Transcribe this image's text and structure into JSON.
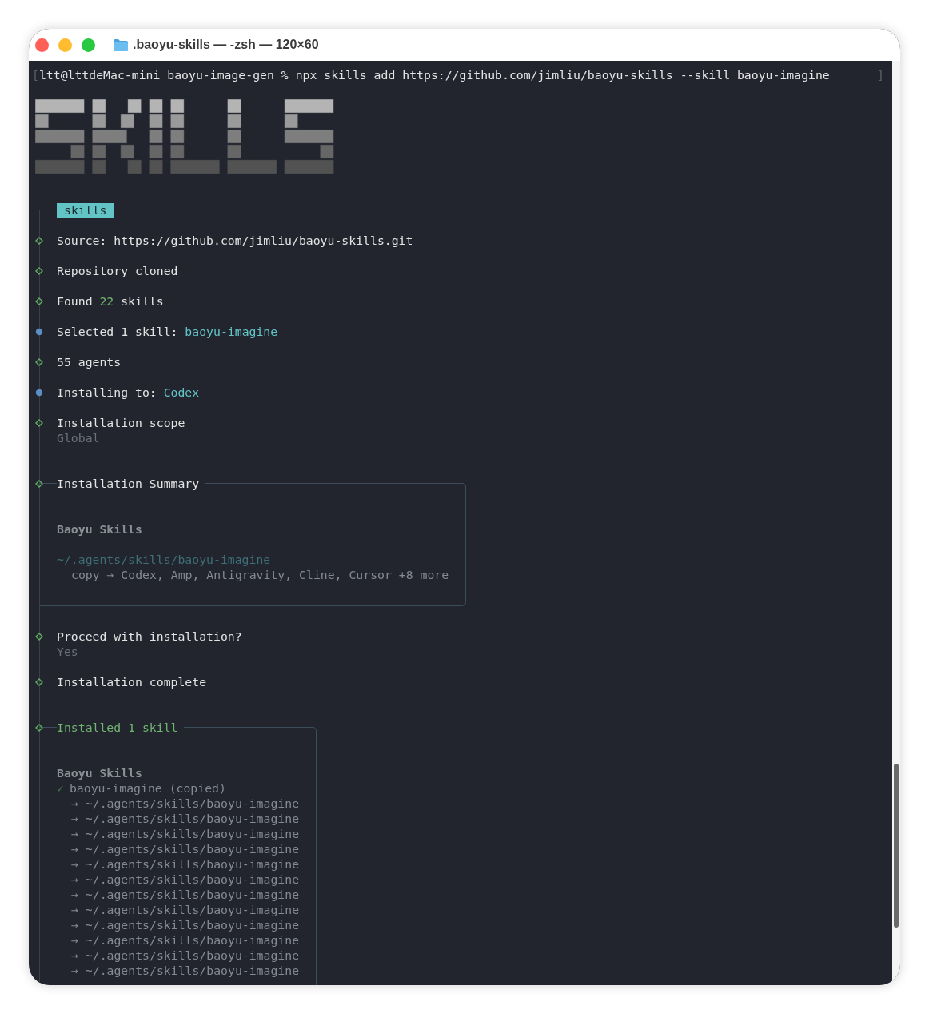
{
  "window": {
    "title": ".baoyu-skills — -zsh — 120×60"
  },
  "terminal": {
    "command": {
      "open_bracket": "[",
      "text": "ltt@lttdeMac-mini baoyu-image-gen % npx skills add https://github.com/jimliu/baoyu-skills --skill baoyu-imagine",
      "close_bracket": "]"
    },
    "badge": "skills",
    "entries": [
      {
        "kind": "step",
        "active": false,
        "parts": [
          {
            "text": "Source: https://github.com/jimliu/baoyu-skills.git",
            "kind": "plain"
          }
        ]
      },
      {
        "kind": "step",
        "active": false,
        "parts": [
          {
            "text": "Repository cloned",
            "kind": "plain"
          }
        ]
      },
      {
        "kind": "step",
        "active": false,
        "parts": [
          {
            "text": "Found ",
            "kind": "plain"
          },
          {
            "text": "22",
            "kind": "number"
          },
          {
            "text": " skills",
            "kind": "plain"
          }
        ]
      },
      {
        "kind": "step",
        "active": true,
        "parts": [
          {
            "text": "Selected 1 skill: ",
            "kind": "plain"
          },
          {
            "text": "baoyu-imagine",
            "kind": "accent"
          }
        ]
      },
      {
        "kind": "step",
        "active": false,
        "parts": [
          {
            "text": "55 agents",
            "kind": "plain"
          }
        ]
      },
      {
        "kind": "step",
        "active": true,
        "parts": [
          {
            "text": "Installing to: ",
            "kind": "plain"
          },
          {
            "text": "Codex",
            "kind": "accent"
          }
        ]
      },
      {
        "kind": "step",
        "active": false,
        "parts": [
          {
            "text": "Installation scope",
            "kind": "plain"
          }
        ],
        "detail": "Global"
      },
      {
        "kind": "box",
        "active": false,
        "title": "Installation Summary",
        "title_success": false,
        "lines": [
          {
            "kind": "blank"
          },
          {
            "kind": "blank"
          },
          {
            "kind": "heading",
            "text": "Baoyu Skills"
          },
          {
            "kind": "blank"
          },
          {
            "kind": "path",
            "text": "~/.agents/skills/baoyu-imagine"
          },
          {
            "kind": "note",
            "text": "copy → Codex, Amp, Antigravity, Cline, Cursor +8 more"
          },
          {
            "kind": "blank"
          }
        ]
      },
      {
        "kind": "step",
        "active": false,
        "parts": [
          {
            "text": "Proceed with installation?",
            "kind": "plain"
          }
        ],
        "detail": "Yes"
      },
      {
        "kind": "step",
        "active": false,
        "parts": [
          {
            "text": "Installation complete",
            "kind": "plain"
          }
        ]
      },
      {
        "kind": "box",
        "active": false,
        "title": "Installed 1 skill",
        "title_success": true,
        "lines": [
          {
            "kind": "blank"
          },
          {
            "kind": "blank"
          },
          {
            "kind": "heading",
            "text": "Baoyu Skills"
          },
          {
            "kind": "check",
            "mark": "✓",
            "text": "baoyu-imagine (copied)"
          },
          {
            "kind": "note",
            "text": "→ ~/.agents/skills/baoyu-imagine"
          },
          {
            "kind": "note",
            "text": "→ ~/.agents/skills/baoyu-imagine"
          },
          {
            "kind": "note",
            "text": "→ ~/.agents/skills/baoyu-imagine"
          },
          {
            "kind": "note",
            "text": "→ ~/.agents/skills/baoyu-imagine"
          },
          {
            "kind": "note",
            "text": "→ ~/.agents/skills/baoyu-imagine"
          },
          {
            "kind": "note",
            "text": "→ ~/.agents/skills/baoyu-imagine"
          },
          {
            "kind": "note",
            "text": "→ ~/.agents/skills/baoyu-imagine"
          },
          {
            "kind": "note",
            "text": "→ ~/.agents/skills/baoyu-imagine"
          },
          {
            "kind": "note",
            "text": "→ ~/.agents/skills/baoyu-imagine"
          },
          {
            "kind": "note",
            "text": "→ ~/.agents/skills/baoyu-imagine"
          },
          {
            "kind": "note",
            "text": "→ ~/.agents/skills/baoyu-imagine"
          },
          {
            "kind": "note",
            "text": "→ ~/.agents/skills/baoyu-imagine"
          },
          {
            "kind": "blank"
          },
          {
            "kind": "blank"
          }
        ]
      }
    ]
  }
}
